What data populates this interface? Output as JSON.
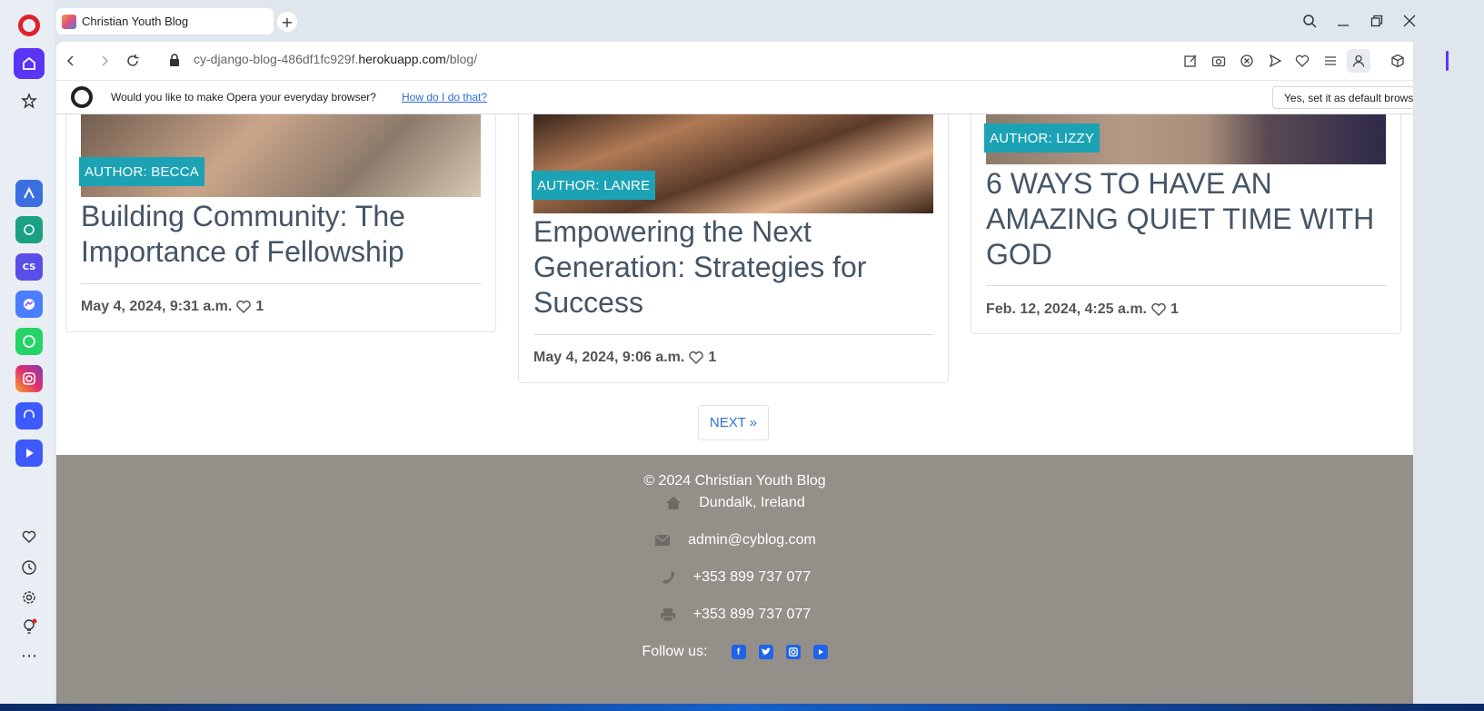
{
  "browser": {
    "tab_title": "Christian Youth Blog",
    "new_tab": "+",
    "url_prefix": "cy-django-blog-486df1fc929f.",
    "url_host": "herokuapp.com",
    "url_path": "/blog/"
  },
  "infobar": {
    "message": "Would you like to make Opera your everyday browser?",
    "link": "How do I do that?",
    "button": "Yes, set it as default browser",
    "close": "×"
  },
  "posts": [
    {
      "author": "AUTHOR: BECCA",
      "title": "Building Community: The Importance of Fellowship",
      "date": "May 4, 2024, 9:31 a.m.",
      "likes": "1"
    },
    {
      "author": "AUTHOR: LANRE",
      "title": "Empowering the Next Generation: Strategies for Success",
      "date": "May 4, 2024, 9:06 a.m.",
      "likes": "1"
    },
    {
      "author": "AUTHOR: LIZZY",
      "title": "6 WAYS TO HAVE AN AMAZING QUIET TIME WITH GOD",
      "date": "Feb. 12, 2024, 4:25 a.m.",
      "likes": "1"
    }
  ],
  "pagination": {
    "next": "NEXT »"
  },
  "footer": {
    "copyright": "© 2024 Christian Youth Blog",
    "address": "Dundalk, Ireland",
    "email": "admin@cyblog.com",
    "phone": "+353 899 737 077",
    "fax": "+353 899 737 077",
    "follow": "Follow us:"
  },
  "colors": {
    "author_badge": "#1ba3b5",
    "footer_bg": "#958f8a",
    "link": "#2f6fd6",
    "opera_red": "#e0212b",
    "sidebar_active": "#5b35f5"
  }
}
